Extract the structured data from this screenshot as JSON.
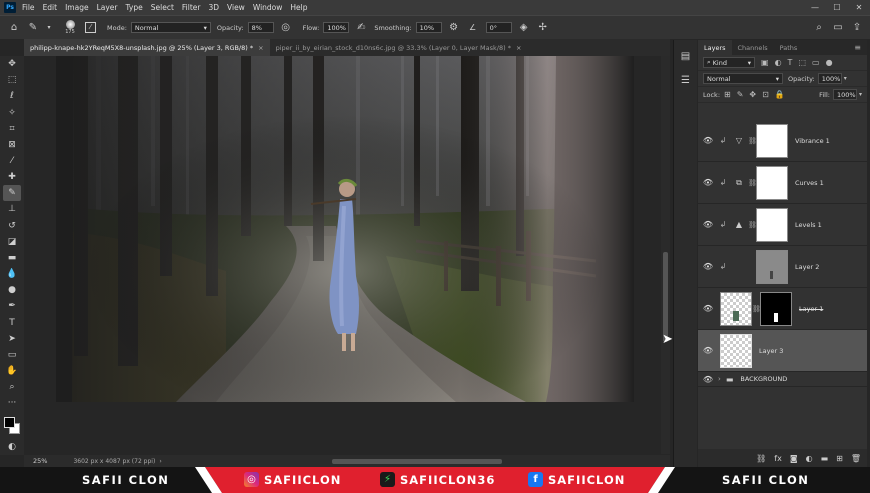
{
  "menubar": {
    "logo": "Ps",
    "items": [
      "File",
      "Edit",
      "Image",
      "Layer",
      "Type",
      "Select",
      "Filter",
      "3D",
      "View",
      "Window",
      "Help"
    ],
    "controls": [
      "—",
      "☐",
      "✕"
    ]
  },
  "options": {
    "brush_size": "175",
    "mode_label": "Mode:",
    "mode_value": "Normal",
    "opacity_label": "Opacity:",
    "opacity_value": "8%",
    "flow_label": "Flow:",
    "flow_value": "100%",
    "smoothing_label": "Smoothing:",
    "smoothing_value": "10%",
    "angle_value": "0°"
  },
  "tabs": [
    {
      "label": "philipp-knape-hk2YReqM5X8-unsplash.jpg @ 25% (Layer 3, RGB/8) *",
      "close": "×"
    },
    {
      "label": "piper_ii_by_eirian_stock_d10ns6c.jpg @ 33.3% (Layer 0, Layer Mask/8) *",
      "close": "×"
    }
  ],
  "status": {
    "zoom": "25%",
    "doc": "3602 px x 4087 px (72 ppi)"
  },
  "panel": {
    "tabs": [
      "Layers",
      "Channels",
      "Paths"
    ],
    "kind_value": "Kind",
    "blend_value": "Normal",
    "opacity_label": "Opacity:",
    "opacity_value": "100%",
    "lock_label": "Lock:",
    "fill_label": "Fill:",
    "fill_value": "100%",
    "layers": [
      {
        "name": "Vibrance 1",
        "icon": "vibrance-icon"
      },
      {
        "name": "Curves 1",
        "icon": "curves-icon"
      },
      {
        "name": "Levels 1",
        "icon": "levels-icon"
      },
      {
        "name": "Layer 2"
      },
      {
        "name": "Layer 1"
      },
      {
        "name": "Layer 3"
      }
    ],
    "group_name": "BACKGROUND"
  },
  "banner": {
    "left_name": "SAFII CLON",
    "instagram": "SAFIICLON",
    "other": "SAFIICLON36",
    "facebook": "SAFIICLON",
    "right_name": "SAFII CLON"
  },
  "colors": {
    "accent": "#31a8ff",
    "banner_red": "#e0202e"
  }
}
